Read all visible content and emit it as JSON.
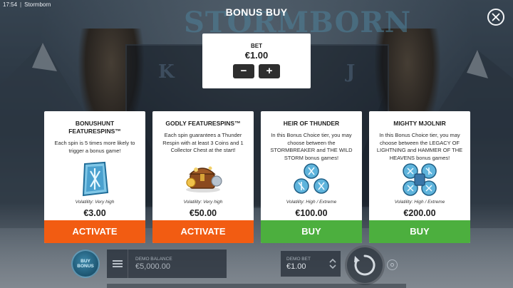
{
  "topbar": {
    "time": "17:54",
    "separator": "|",
    "game_name": "Stormborn"
  },
  "background": {
    "logo_text": "STORMBORN",
    "reel_letters": [
      "K",
      "J"
    ]
  },
  "modal": {
    "title": "BONUS BUY",
    "close_icon": "close-x-icon"
  },
  "bet": {
    "label": "BET",
    "value": "€1.00",
    "minus_label": "−",
    "plus_label": "+"
  },
  "cards": [
    {
      "title": "BONUSHUNT FEATURESPINS™",
      "description": "Each spin is 5 times more likely to trigger a bonus game!",
      "volatility": "Volatility: Very high",
      "price": "€3.00",
      "button_label": "ACTIVATE",
      "button_color": "#f25c12",
      "icon": "rune-x-icon"
    },
    {
      "title": "GODLY FEATURESPINS™",
      "description": "Each spin guarantees a Thunder Respin with at least 3 Coins and 1 Collector Chest at the start!",
      "volatility": "Volatility: Very high",
      "price": "€50.00",
      "button_label": "ACTIVATE",
      "button_color": "#f25c12",
      "icon": "treasure-chest-icon"
    },
    {
      "title": "HEIR OF THUNDER",
      "description": "In this Bonus Choice tier, you may choose between the STORMBREAKER and THE WILD STORM bonus games!",
      "volatility": "Volatility: High / Extreme",
      "price": "€100.00",
      "button_label": "BUY",
      "button_color": "#4caf3e",
      "icon": "rune-trio-icon"
    },
    {
      "title": "MIGHTY MJOLNIR",
      "description": "In this Bonus Choice tier, you may choose between the LEGACY OF LIGHTNING and HAMMER OF THE HEAVENS bonus games!",
      "volatility": "Volatility: High / Extreme",
      "price": "€200.00",
      "button_label": "BUY",
      "button_color": "#4caf3e",
      "icon": "rune-quad-icon"
    }
  ],
  "bottom": {
    "buy_bonus_label": "BUY BONUS",
    "balance_label": "DEMO BALANCE",
    "balance_value": "€5,000.00",
    "demo_bet_label": "DEMO BET",
    "demo_bet_value": "€1.00"
  },
  "colors": {
    "activate": "#f25c12",
    "buy": "#4caf3e",
    "rune_blue": "#2a7fb0"
  }
}
